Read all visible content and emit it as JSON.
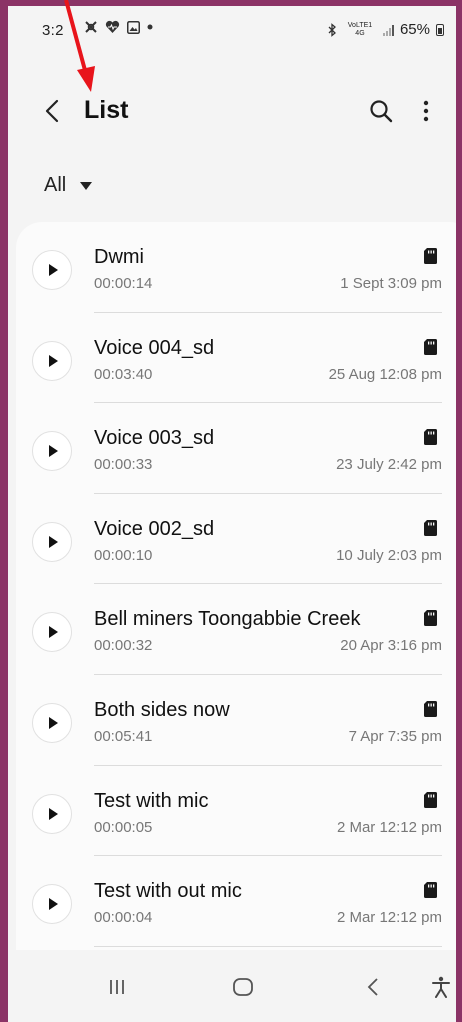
{
  "status_bar": {
    "time": "3:2",
    "signal_text": "VoLTE1 4G",
    "battery": "65%"
  },
  "header": {
    "title": "List"
  },
  "filter": {
    "label": "All"
  },
  "recordings": [
    {
      "title": "Dwmi",
      "duration": "00:00:14",
      "date": "1 Sept 3:09 pm"
    },
    {
      "title": "Voice 004_sd",
      "duration": "00:03:40",
      "date": "25 Aug 12:08 pm"
    },
    {
      "title": "Voice 003_sd",
      "duration": "00:00:33",
      "date": "23 July 2:42 pm"
    },
    {
      "title": "Voice 002_sd",
      "duration": "00:00:10",
      "date": "10 July 2:03 pm"
    },
    {
      "title": "Bell miners Toongabbie Creek",
      "duration": "00:00:32",
      "date": "20 Apr 3:16 pm"
    },
    {
      "title": "Both sides now",
      "duration": "00:05:41",
      "date": "7 Apr 7:35 pm"
    },
    {
      "title": "Test with mic",
      "duration": "00:00:05",
      "date": "2 Mar 12:12 pm"
    },
    {
      "title": "Test with out mic",
      "duration": "00:00:04",
      "date": "2 Mar 12:12 pm"
    }
  ],
  "icons": {
    "item_play": "play-icon",
    "item_storage": "sd-card-icon",
    "back": "back-arrow-icon",
    "search": "search-icon",
    "more": "more-options-icon",
    "nav_recents": "recents-icon",
    "nav_home": "home-icon",
    "nav_back": "nav-back-icon",
    "accessibility": "accessibility-icon"
  },
  "colors": {
    "frame_border": "#8b3366",
    "annotation_arrow": "#e8141b",
    "background": "#f4f4f4",
    "card": "#fbfbfb"
  }
}
